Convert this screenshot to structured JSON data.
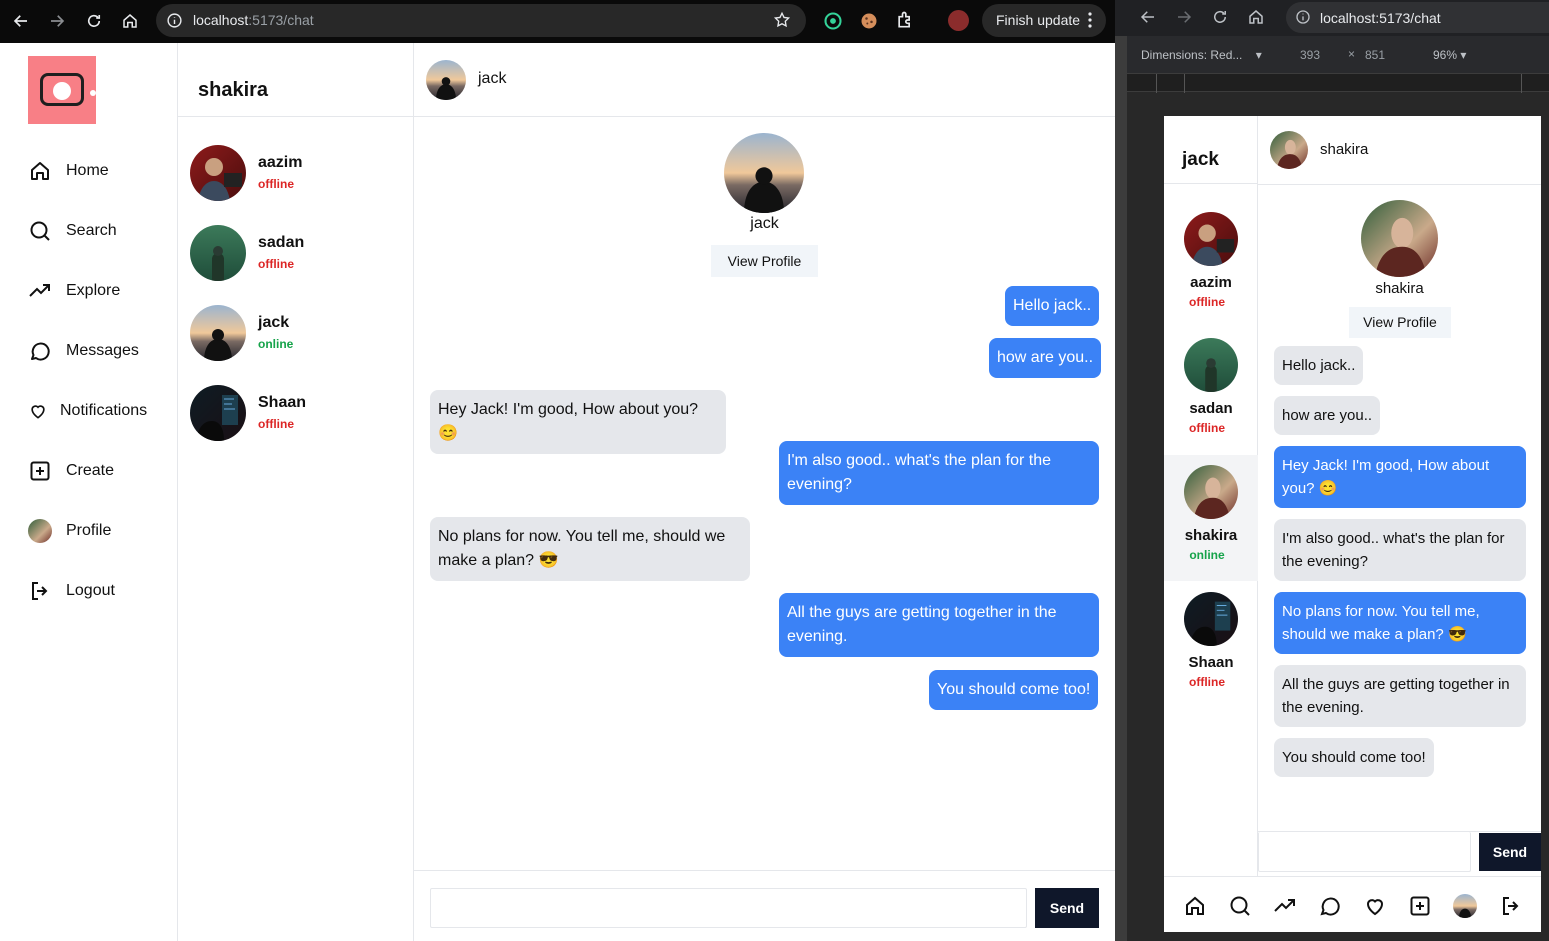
{
  "browser_left": {
    "url_host": "localhost",
    "url_rest": ":5173/chat",
    "finish_update": "Finish update",
    "icons": [
      "back-arrow-icon",
      "forward-arrow-icon",
      "reload-icon",
      "home-icon",
      "info-icon",
      "star-icon",
      "extension-icon",
      "more-vert-icon"
    ]
  },
  "app": {
    "logo": "camera-icon",
    "nav": [
      {
        "label": "Home",
        "icon": "home-icon"
      },
      {
        "label": "Search",
        "icon": "search-icon"
      },
      {
        "label": "Explore",
        "icon": "trending-icon"
      },
      {
        "label": "Messages",
        "icon": "message-circle-icon"
      },
      {
        "label": "Notifications",
        "icon": "heart-icon"
      },
      {
        "label": "Create",
        "icon": "plus-square-icon"
      },
      {
        "label": "Profile",
        "icon": "profile-avatar"
      },
      {
        "label": "Logout",
        "icon": "logout-icon"
      }
    ],
    "current_user": "shakira",
    "users": [
      {
        "name": "aazim",
        "status": "offline"
      },
      {
        "name": "sadan",
        "status": "offline"
      },
      {
        "name": "jack",
        "status": "online"
      },
      {
        "name": "Shaan",
        "status": "offline"
      }
    ],
    "chat": {
      "partner": "jack",
      "view_profile": "View Profile",
      "messages": [
        {
          "from": "me",
          "text": "Hello jack.."
        },
        {
          "from": "me",
          "text": "how are you.."
        },
        {
          "from": "them",
          "text": "Hey Jack! I'm good, How about you? 😊"
        },
        {
          "from": "me",
          "text": "I'm also good.. what's the plan for the evening?"
        },
        {
          "from": "them",
          "text": "No plans for now. You tell me, should we make a plan? 😎"
        },
        {
          "from": "me",
          "text": "All the guys are getting together in the evening."
        },
        {
          "from": "me",
          "text": "You should come too!"
        }
      ],
      "input_value": "",
      "send": "Send"
    }
  },
  "browser_right": {
    "url_host": "localhost",
    "url_rest": ":5173/chat",
    "dimensions_label": "Dimensions: Red...",
    "width": "393",
    "times": "×",
    "height": "851",
    "zoom": "96%"
  },
  "device": {
    "current_user": "jack",
    "users": [
      {
        "name": "aazim",
        "status": "offline"
      },
      {
        "name": "sadan",
        "status": "offline"
      },
      {
        "name": "shakira",
        "status": "online"
      },
      {
        "name": "Shaan",
        "status": "offline"
      }
    ],
    "chat": {
      "partner": "shakira",
      "view_profile": "View Profile",
      "messages": [
        {
          "from": "them",
          "text": "Hello jack.."
        },
        {
          "from": "them",
          "text": "how are you.."
        },
        {
          "from": "me",
          "text": "Hey Jack! I'm good, How about you? 😊"
        },
        {
          "from": "them",
          "text": "I'm also good.. what's the plan for the evening?"
        },
        {
          "from": "me",
          "text": "No plans for now. You tell me, should we make a plan? 😎"
        },
        {
          "from": "them",
          "text": "All the guys are getting together in the evening."
        },
        {
          "from": "them",
          "text": "You should come too!"
        }
      ],
      "send": "Send"
    },
    "bottom_nav_icons": [
      "home-icon",
      "search-icon",
      "trending-icon",
      "message-circle-icon",
      "heart-icon",
      "plus-square-icon",
      "profile-avatar",
      "logout-icon"
    ]
  },
  "colors": {
    "accent": "#3b82f6",
    "logo_bg": "#f87f86",
    "offline": "#dc2626",
    "online": "#16a34a",
    "send_bg": "#0f172a"
  }
}
